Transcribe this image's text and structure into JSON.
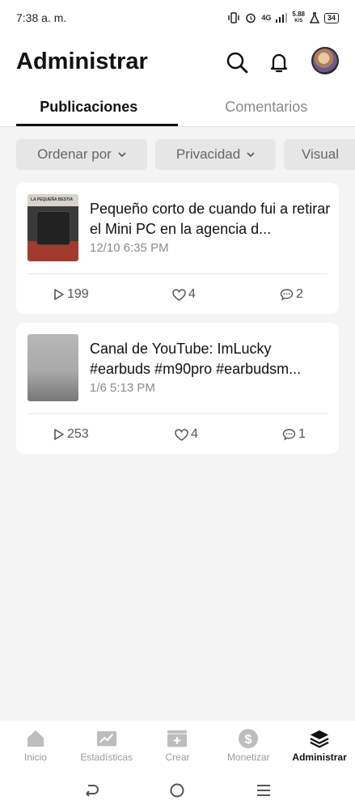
{
  "status_bar": {
    "time": "7:38 a. m.",
    "network": "4G",
    "speed_value": "5.88",
    "speed_unit": "K/S",
    "battery": "34"
  },
  "header": {
    "title": "Administrar",
    "tabs": [
      {
        "label": "Publicaciones",
        "active": true
      },
      {
        "label": "Comentarios",
        "active": false
      }
    ]
  },
  "filters": [
    {
      "label": "Ordenar por"
    },
    {
      "label": "Privacidad"
    },
    {
      "label": "Visual"
    }
  ],
  "posts": [
    {
      "title": "Pequeño corto de cuando fui a retirar el Mini PC en la agencia d...",
      "date": "12/10 6:35 PM",
      "views": "199",
      "likes": "4",
      "comments": "2",
      "thumb_label": "LA PEQUEÑA BESTIA"
    },
    {
      "title": "Canal de YouTube: ImLucky #earbuds #m90pro #earbudsm...",
      "date": "1/6 5:13 PM",
      "views": "253",
      "likes": "4",
      "comments": "1"
    }
  ],
  "bottom_nav": [
    {
      "label": "Inicio",
      "icon": "home-icon"
    },
    {
      "label": "Estadísticas",
      "icon": "chart-icon"
    },
    {
      "label": "Crear",
      "icon": "create-icon"
    },
    {
      "label": "Monetizar",
      "icon": "dollar-icon"
    },
    {
      "label": "Administrar",
      "icon": "layers-icon",
      "active": true
    }
  ],
  "colors": {
    "accent": "#111111",
    "muted": "#8a8a8a",
    "background": "#f4f4f4"
  }
}
